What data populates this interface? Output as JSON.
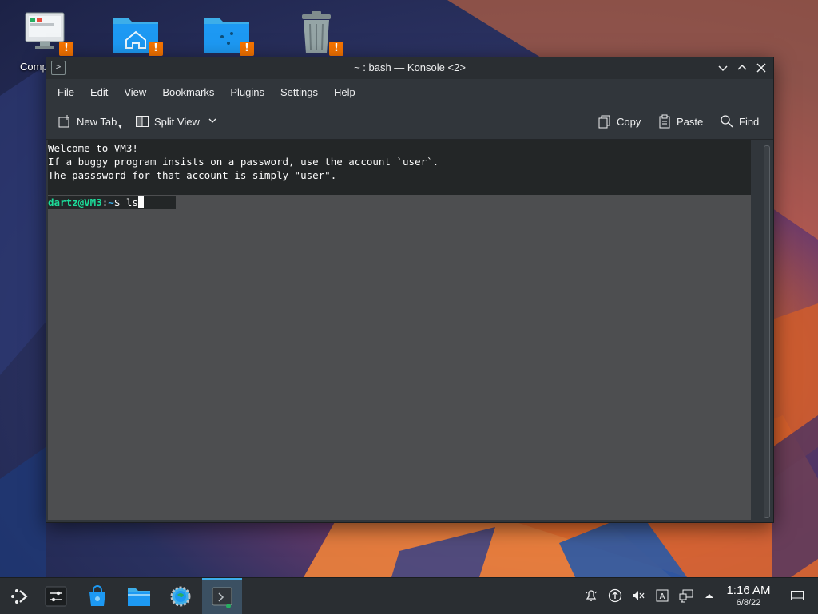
{
  "desktop": {
    "icons": [
      {
        "name": "computer",
        "label": "Comp"
      },
      {
        "name": "home-folder",
        "label": ""
      },
      {
        "name": "network-folder",
        "label": ""
      },
      {
        "name": "trash",
        "label": ""
      }
    ],
    "warning_glyph": "!"
  },
  "window": {
    "title": "~ : bash — Konsole <2>",
    "menu": [
      "File",
      "Edit",
      "View",
      "Bookmarks",
      "Plugins",
      "Settings",
      "Help"
    ],
    "toolbar": {
      "new_tab": "New Tab",
      "split_view": "Split View",
      "copy": "Copy",
      "paste": "Paste",
      "find": "Find"
    },
    "terminal": {
      "lines": [
        "Welcome to VM3!",
        "If a buggy program insists on a password, use the account `user`.",
        "The passsword for that account is simply \"user\"."
      ],
      "prompt_user": "dartz@VM3",
      "prompt_sep": ":",
      "prompt_path": "~",
      "prompt_symbol": "$ ",
      "command": "ls"
    }
  },
  "taskbar": {
    "apps": [
      "application-launcher",
      "settings-sliders",
      "discover-store",
      "file-manager",
      "system-settings",
      "konsole"
    ],
    "tray": [
      "notifications-icon",
      "updates-icon",
      "volume-muted-icon",
      "input-method-icon",
      "network-icon",
      "show-hidden-icon"
    ],
    "clock": {
      "time": "1:16 AM",
      "date": "6/8/22"
    }
  },
  "colors": {
    "accent": "#3daee9",
    "prompt_user": "#1cdc9a",
    "warning": "#f67400",
    "terminal_bg": "#232627"
  }
}
